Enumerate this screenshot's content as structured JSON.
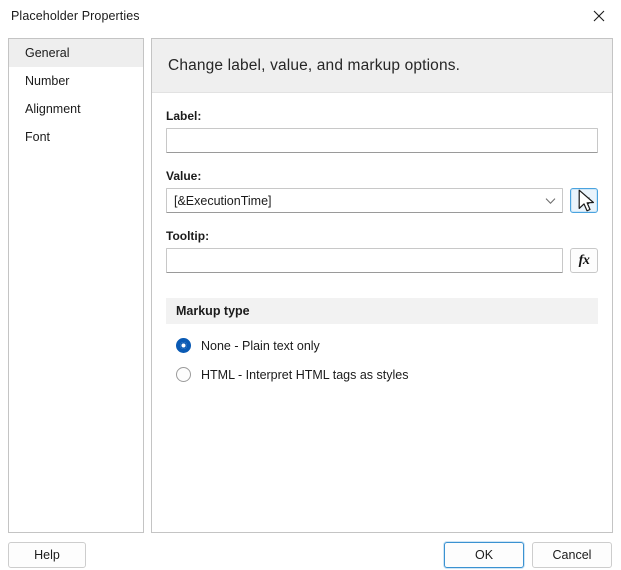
{
  "window": {
    "title": "Placeholder Properties",
    "close_icon": "close-icon"
  },
  "sidebar": {
    "items": [
      {
        "label": "General",
        "selected": true
      },
      {
        "label": "Number",
        "selected": false
      },
      {
        "label": "Alignment",
        "selected": false
      },
      {
        "label": "Font",
        "selected": false
      }
    ]
  },
  "main": {
    "header": "Change label, value, and markup options.",
    "fields": {
      "label": {
        "caption": "Label:",
        "value": "",
        "placeholder": ""
      },
      "value": {
        "caption": "Value:",
        "value": "[&ExecutionTime]",
        "dropdown_icon": "chevron-down-icon",
        "fx_label": "fx",
        "fx_hovered": true
      },
      "tooltip": {
        "caption": "Tooltip:",
        "value": "",
        "placeholder": "",
        "fx_label": "fx",
        "fx_hovered": false
      }
    },
    "markup_group": {
      "title": "Markup type",
      "options": [
        {
          "label": "None - Plain text only",
          "checked": true
        },
        {
          "label": "HTML - Interpret HTML tags as styles",
          "checked": false
        }
      ]
    }
  },
  "footer": {
    "help": "Help",
    "ok": "OK",
    "cancel": "Cancel"
  },
  "colors": {
    "accent_blue": "#0a5ab4",
    "default_button_border": "#3b92d1",
    "hover_fill": "#eaf4fc",
    "band_gray": "#f2f2f2",
    "header_gray": "#efefef",
    "selected_item_gray": "#eeeeee"
  }
}
